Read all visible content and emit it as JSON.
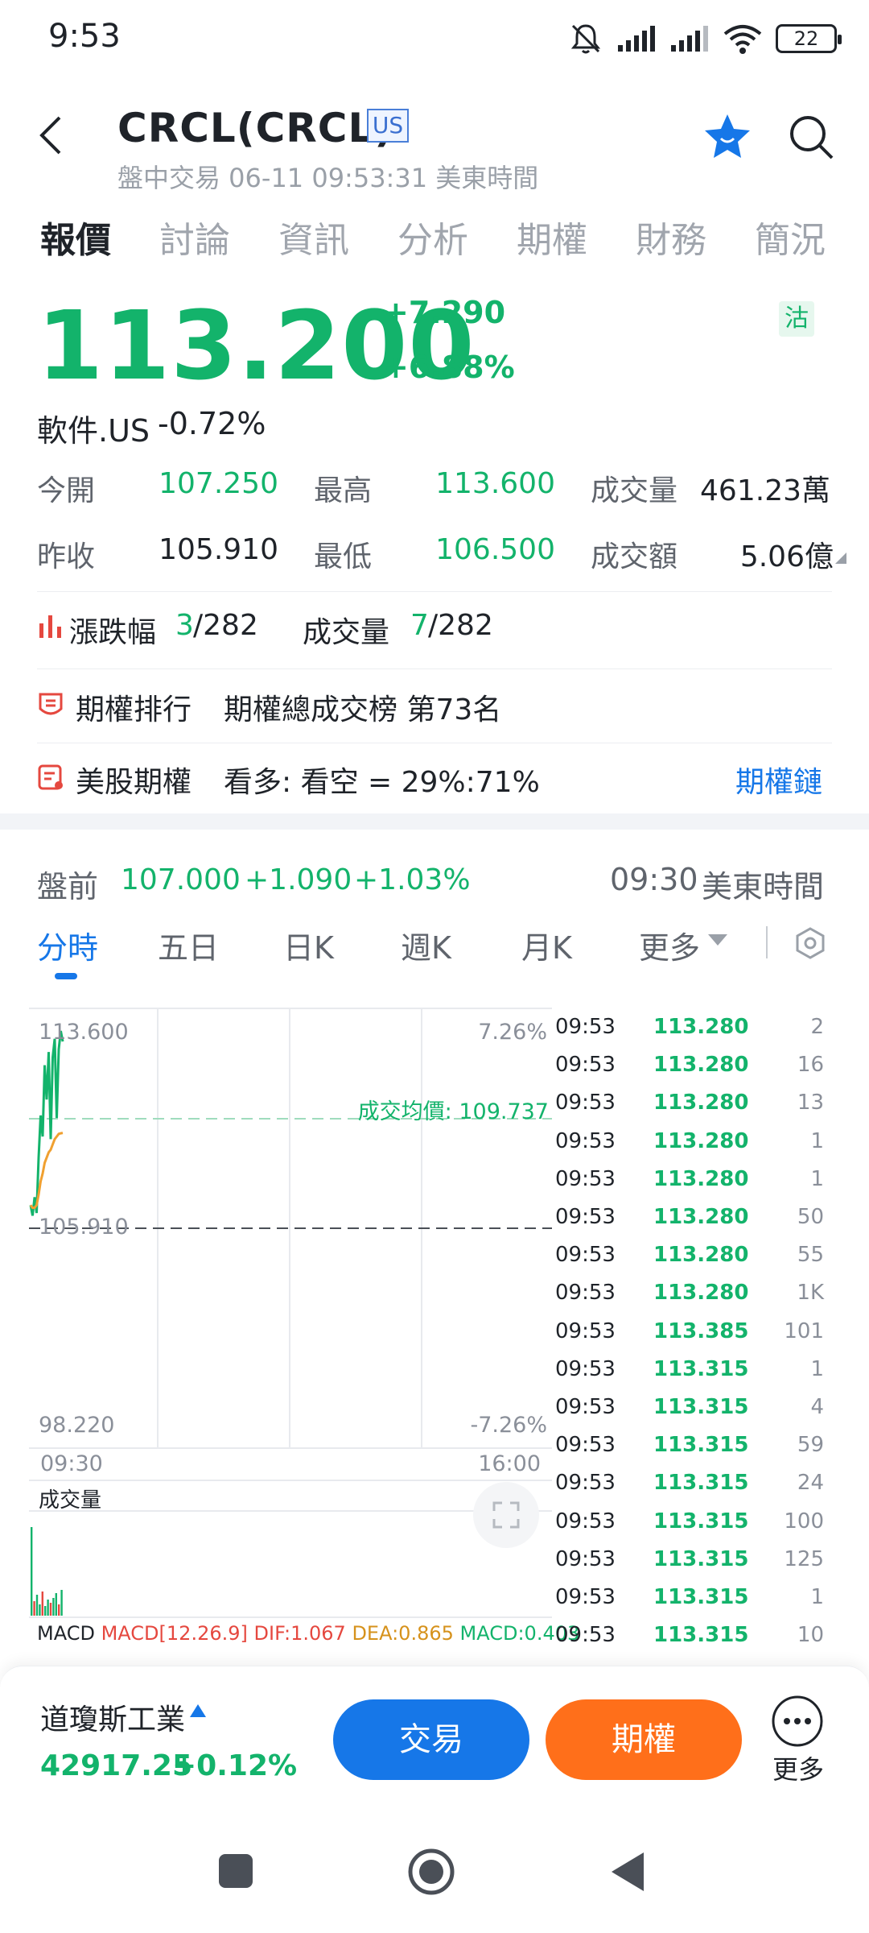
{
  "status": {
    "time": "9:53",
    "battery": "22"
  },
  "header": {
    "title": "CRCL(CRCL)",
    "market_badge": "US",
    "session_info": "盤中交易 06-11 09:53:31 美東時間"
  },
  "tabs": [
    {
      "label": "報價"
    },
    {
      "label": "討論"
    },
    {
      "label": "資訊"
    },
    {
      "label": "分析"
    },
    {
      "label": "期權"
    },
    {
      "label": "財務"
    },
    {
      "label": "簡況"
    }
  ],
  "quote": {
    "price": "113.200",
    "change": "+7.290",
    "change_pct": "+6.88%",
    "short_badge": "沽",
    "sector_label": "軟件.US",
    "sector_change": "-0.72%"
  },
  "stats": {
    "open_label": "今開",
    "open": "107.250",
    "high_label": "最高",
    "high": "113.600",
    "volume_label": "成交量",
    "volume": "461.23萬",
    "prev_close_label": "昨收",
    "prev_close": "105.910",
    "low_label": "最低",
    "low": "106.500",
    "turnover_label": "成交額",
    "turnover": "5.06億"
  },
  "rank": {
    "gain_label": "漲跌幅",
    "gain_rank": "3",
    "gain_total": "/282",
    "volume_label": "成交量",
    "volume_rank": "7",
    "volume_total": "/282"
  },
  "options_rank": {
    "label": "期權排行",
    "text": "期權總成交榜 第73名"
  },
  "us_options": {
    "label": "美股期權",
    "text": "看多: 看空 = 29%:71%",
    "link": "期權鏈"
  },
  "premarket": {
    "label": "盤前",
    "price": "107.000",
    "change": "+1.090",
    "change_pct": "+1.03%",
    "time": "09:30",
    "timezone": "美東時間"
  },
  "chart_tabs": [
    {
      "label": "分時"
    },
    {
      "label": "五日"
    },
    {
      "label": "日K"
    },
    {
      "label": "週K"
    },
    {
      "label": "月K"
    },
    {
      "label": "更多"
    }
  ],
  "chart": {
    "y_high": "113.600",
    "y_mid": "105.910",
    "y_low": "98.220",
    "pct_high": "7.26%",
    "pct_low": "-7.26%",
    "avg_label": "成交均價: 109.737",
    "x_start": "09:30",
    "x_end": "16:00",
    "volume_label": "成交量",
    "macd_label": "MACD",
    "macd_params": "MACD[12.26.9]",
    "dif": "DIF:1.067",
    "dea": "DEA:0.865",
    "macd_value": "MACD:0.403"
  },
  "chart_data": {
    "type": "line",
    "ylim": [
      98.22,
      113.6
    ],
    "series": [
      {
        "values": [
          107.0,
          106.6,
          107.3,
          106.7,
          108.8,
          110.4,
          109.6,
          112.3,
          111.0,
          112.8,
          109.5,
          112.6,
          113.3,
          110.3,
          112.9,
          113.6,
          113.2
        ]
      },
      {
        "values": [
          107.0,
          106.9,
          106.9,
          107.0,
          107.4,
          107.9,
          108.2,
          108.6,
          108.8,
          109.0,
          109.1,
          109.3,
          109.5,
          109.6,
          109.7,
          109.72,
          109.737
        ]
      }
    ]
  },
  "ticks": [
    {
      "time": "09:53",
      "price": "113.280",
      "vol": "2"
    },
    {
      "time": "09:53",
      "price": "113.280",
      "vol": "16"
    },
    {
      "time": "09:53",
      "price": "113.280",
      "vol": "13"
    },
    {
      "time": "09:53",
      "price": "113.280",
      "vol": "1"
    },
    {
      "time": "09:53",
      "price": "113.280",
      "vol": "1"
    },
    {
      "time": "09:53",
      "price": "113.280",
      "vol": "50"
    },
    {
      "time": "09:53",
      "price": "113.280",
      "vol": "55"
    },
    {
      "time": "09:53",
      "price": "113.280",
      "vol": "1K"
    },
    {
      "time": "09:53",
      "price": "113.385",
      "vol": "101"
    },
    {
      "time": "09:53",
      "price": "113.315",
      "vol": "1"
    },
    {
      "time": "09:53",
      "price": "113.315",
      "vol": "4"
    },
    {
      "time": "09:53",
      "price": "113.315",
      "vol": "59"
    },
    {
      "time": "09:53",
      "price": "113.315",
      "vol": "24"
    },
    {
      "time": "09:53",
      "price": "113.315",
      "vol": "100"
    },
    {
      "time": "09:53",
      "price": "113.315",
      "vol": "125"
    },
    {
      "time": "09:53",
      "price": "113.315",
      "vol": "1"
    },
    {
      "time": "09:53",
      "price": "113.315",
      "vol": "10"
    }
  ],
  "bottom": {
    "index_name": "道瓊斯工業",
    "index_value": "42917.25",
    "index_change": "+0.12%",
    "trade_label": "交易",
    "options_label": "期權",
    "more_label": "更多"
  },
  "colors": {
    "up": "#13b36b",
    "down": "#e5483f",
    "accent": "#1677e8",
    "options": "#ff6f1a",
    "avg_line": "#f0a030"
  }
}
